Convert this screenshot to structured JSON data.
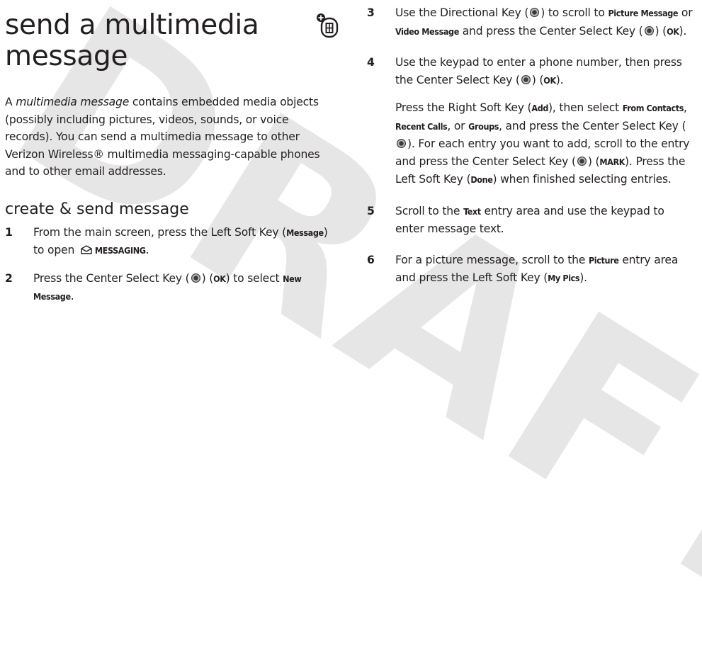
{
  "watermark": "DRAFT",
  "page": {
    "title_line1": "send a multimedia",
    "title_line2": "message",
    "intro_pre": "A ",
    "intro_em": "multimedia message",
    "intro_post": " contains embedded media objects (possibly including pictures, videos, sounds, or voice records). You can send a multimedia message to other Verizon Wireless® multimedia messaging-capable phones and to other email addresses.",
    "section_heading": "create & send message"
  },
  "steps": {
    "s1": {
      "num": "1",
      "t1": "From the main screen, press the Left Soft Key (",
      "k1": "Message",
      "t2": ") to open ",
      "k2": "MESSAGING",
      "t3": "."
    },
    "s2": {
      "num": "2",
      "t1": "Press the Center Select Key (",
      "t2": ") (",
      "k1": "OK",
      "t3": ") to select ",
      "k2": "New Message",
      "t4": "."
    },
    "s3": {
      "num": "3",
      "t1": "Use the Directional Key (",
      "t2": ") to scroll to ",
      "k1": "Picture Message",
      "t3": " or ",
      "k2": "Video Message",
      "t4": " and press the Center Select Key (",
      "t5": ") (",
      "k3": "OK",
      "t6": ")."
    },
    "s4": {
      "num": "4",
      "t1": "Use the keypad to enter a phone number, then press the Center Select Key (",
      "t2": ") (",
      "k1": "OK",
      "t3": ")."
    },
    "s4b": {
      "t1": "Press the Right Soft Key (",
      "k1": "Add",
      "t2": "), then select ",
      "k2": "From Contacts",
      "t3": ", ",
      "k3": "Recent Calls",
      "t4": ", or ",
      "k4": "Groups",
      "t5": ", and press the Center Select Key (",
      "t6": "). For each entry you want to add, scroll to the entry and press the Center Select Key (",
      "t7": ") (",
      "k5": "MARK",
      "t8": "). Press the Left Soft Key (",
      "k6": "Done",
      "t9": ") when finished selecting entries."
    },
    "s5": {
      "num": "5",
      "t1": "Scroll to the ",
      "k1": "Text",
      "t2": " entry area and use the keypad to enter message text."
    },
    "s6": {
      "num": "6",
      "t1": "For a picture message, scroll to the ",
      "k1": "Picture",
      "t2": " entry area and press the Left Soft Key (",
      "k2": "My Pics",
      "t3": ")."
    }
  },
  "icons": {
    "feature": "feature-availability-icon",
    "messaging": "messaging-envelope-icon",
    "center_key": "center-select-key-icon",
    "directional_key": "directional-key-icon"
  }
}
